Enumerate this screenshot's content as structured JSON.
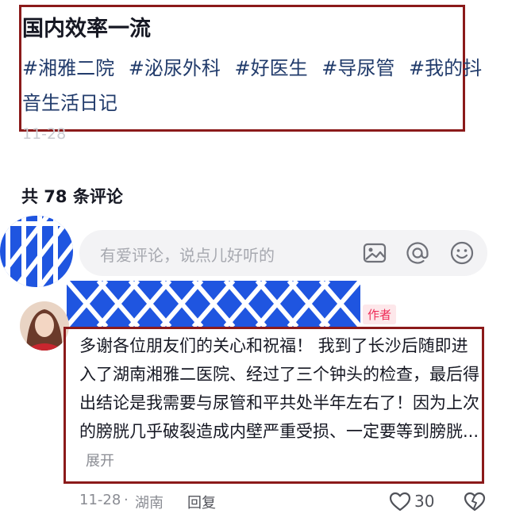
{
  "post": {
    "title": "国内效率一流",
    "hashtags": [
      "#湘雅二院",
      "#泌尿外科",
      "#好医生",
      "#导尿管",
      "#我的抖音生活日记"
    ],
    "date": "11-28"
  },
  "comments_section": {
    "count_label": "共 78 条评论",
    "input_placeholder": "有爱评论，说点儿好听的",
    "icons": {
      "image": "image-icon",
      "mention": "at-icon",
      "emoji": "emoji-icon"
    }
  },
  "comment": {
    "author_badge": "作者",
    "text": "多谢各位朋友们的关心和祝福！ 我到了长沙后随即进入了湖南湘雅二医院、经过了三个钟头的检查，最后得出结论是我需要与尿管和平共处半年左右了！因为上次的膀胱几乎破裂造成内壁严重受损、一定要等到膀胱...",
    "expand_label": "展开",
    "date": "11-28",
    "separator": "·",
    "location": "湖南",
    "reply_label": "回复",
    "likes": "30"
  },
  "colors": {
    "hashtag": "#213b6b",
    "highlight_border": "#8b1a1a",
    "censor_blue": "#1f55e0",
    "badge_text": "#ee2a57"
  }
}
